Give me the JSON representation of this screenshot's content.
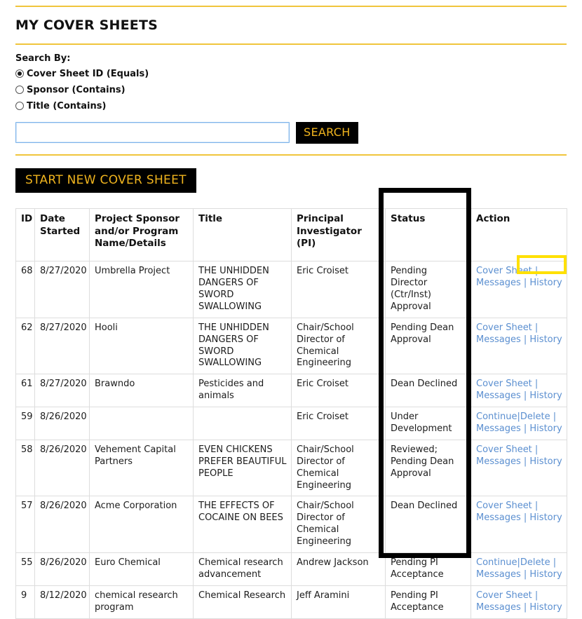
{
  "header": {
    "title": "MY COVER SHEETS"
  },
  "search": {
    "label": "Search By:",
    "options": [
      {
        "label": "Cover Sheet ID (Equals)",
        "selected": true
      },
      {
        "label": "Sponsor (Contains)",
        "selected": false
      },
      {
        "label": "Title (Contains)",
        "selected": false
      }
    ],
    "input_value": "",
    "input_placeholder": "",
    "button_label": "SEARCH"
  },
  "actions": {
    "start_new_label": "START NEW COVER SHEET"
  },
  "table": {
    "columns": [
      "ID",
      "Date Started",
      "Project Sponsor and/or Program Name/Details",
      "Title",
      "Principal Investigator (PI)",
      "Status",
      "Action"
    ],
    "rows": [
      {
        "id": "68",
        "date": "8/27/2020",
        "sponsor": "Umbrella Project",
        "title": "THE UNHIDDEN DANGERS OF SWORD SWALLOWING",
        "pi": "Eric Croiset",
        "status": "Pending Director (Ctr/Inst) Approval",
        "actions": [
          "Cover Sheet",
          "Messages",
          "History"
        ]
      },
      {
        "id": "62",
        "date": "8/27/2020",
        "sponsor": "Hooli",
        "title": "THE UNHIDDEN DANGERS OF SWORD SWALLOWING",
        "pi": "Chair/School Director of Chemical Engineering",
        "status": "Pending Dean Approval",
        "actions": [
          "Cover Sheet",
          "Messages",
          "History"
        ]
      },
      {
        "id": "61",
        "date": "8/27/2020",
        "sponsor": "Brawndo",
        "title": "Pesticides and animals",
        "pi": "Eric Croiset",
        "status": "Dean Declined",
        "actions": [
          "Cover Sheet",
          "Messages",
          "History"
        ]
      },
      {
        "id": "59",
        "date": "8/26/2020",
        "sponsor": "",
        "title": "",
        "pi": "Eric Croiset",
        "status": "Under Development",
        "actions": [
          "Continue",
          "Delete",
          "Messages",
          "History"
        ]
      },
      {
        "id": "58",
        "date": "8/26/2020",
        "sponsor": "Vehement Capital Partners",
        "title": "EVEN CHICKENS PREFER BEAUTIFUL PEOPLE",
        "pi": "Chair/School Director of Chemical Engineering",
        "status": "Reviewed; Pending Dean Approval",
        "actions": [
          "Cover Sheet",
          "Messages",
          "History"
        ]
      },
      {
        "id": "57",
        "date": "8/26/2020",
        "sponsor": "Acme Corporation",
        "title": "THE EFFECTS OF COCAINE ON BEES",
        "pi": "Chair/School Director of Chemical Engineering",
        "status": "Dean Declined",
        "actions": [
          "Cover Sheet",
          "Messages",
          "History"
        ]
      },
      {
        "id": "55",
        "date": "8/26/2020",
        "sponsor": "Euro Chemical",
        "title": "Chemical research advancement",
        "pi": "Andrew Jackson",
        "status": "Pending PI Acceptance",
        "actions": [
          "Continue",
          "Delete",
          "Messages",
          "History"
        ]
      },
      {
        "id": "9",
        "date": "8/12/2020",
        "sponsor": "chemical research program",
        "title": "Chemical Research",
        "pi": "Jeff Aramini",
        "status": "Pending PI Acceptance",
        "actions": [
          "Cover Sheet",
          "Messages",
          "History"
        ]
      }
    ]
  },
  "annotations": {
    "status_column_box_color": "#000000",
    "history_link_box_color": "#ffe000"
  },
  "colors": {
    "rule": "#f0c53c",
    "button_bg": "#000000",
    "button_text": "#f0b41e",
    "link": "#5b8fd0"
  }
}
